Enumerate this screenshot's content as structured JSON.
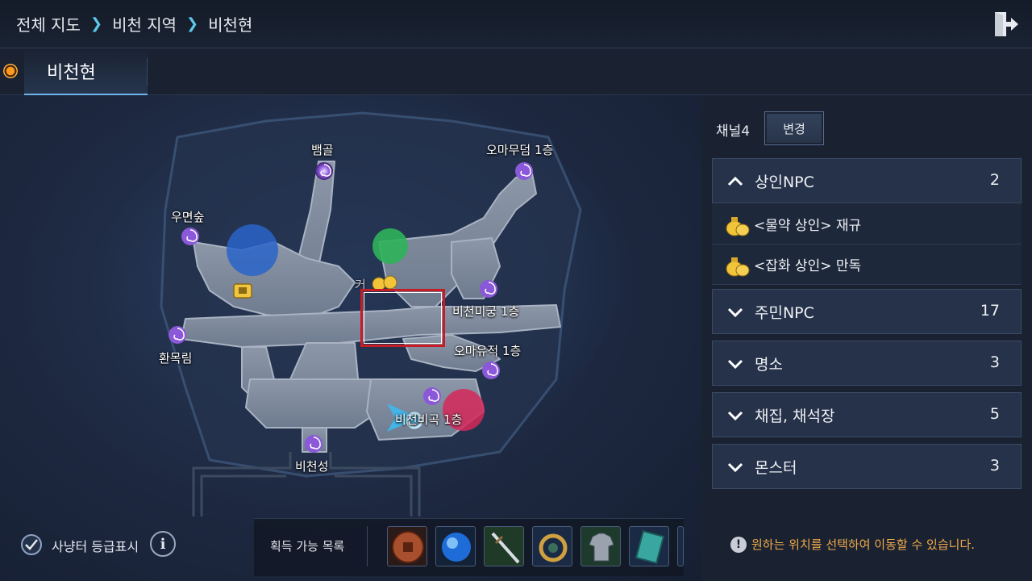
{
  "breadcrumb": {
    "items": [
      "전체 지도",
      "비천 지역",
      "비천현"
    ]
  },
  "tab": {
    "active_label": "비천현"
  },
  "map": {
    "locations": [
      "뱀골",
      "오마무덤 1층",
      "우면숲",
      "비천미궁 1층",
      "환목림",
      "오마유적 1층",
      "비천비곡 1층",
      "비천성"
    ],
    "partial_label": "커"
  },
  "bottom": {
    "obtain_label": "획득 가능 목록",
    "legend_label": "사냥터 등급표시",
    "info_glyph": "i",
    "items": [
      "ancient-coin-icon",
      "blue-orb-icon",
      "sword-icon",
      "dragon-ring-icon",
      "armor-icon",
      "skill-book-icon"
    ]
  },
  "side": {
    "channel_label": "채널4",
    "channel_button": "변경",
    "categories": [
      {
        "label": "상인NPC",
        "count": "2",
        "expanded": true,
        "items": [
          "<물약 상인> 재규",
          "<잡화 상인> 만독"
        ]
      },
      {
        "label": "주민NPC",
        "count": "17",
        "expanded": false
      },
      {
        "label": "명소",
        "count": "3",
        "expanded": false
      },
      {
        "label": "채집, 채석장",
        "count": "5",
        "expanded": false
      },
      {
        "label": "몬스터",
        "count": "3",
        "expanded": false
      }
    ],
    "hint_icon": "!",
    "hint": "원하는 위치를 선택하여 이동할 수 있습니다."
  },
  "colors": {
    "accent": "#5cc8e8",
    "hint": "#f0a948",
    "select": "#c71b25"
  }
}
